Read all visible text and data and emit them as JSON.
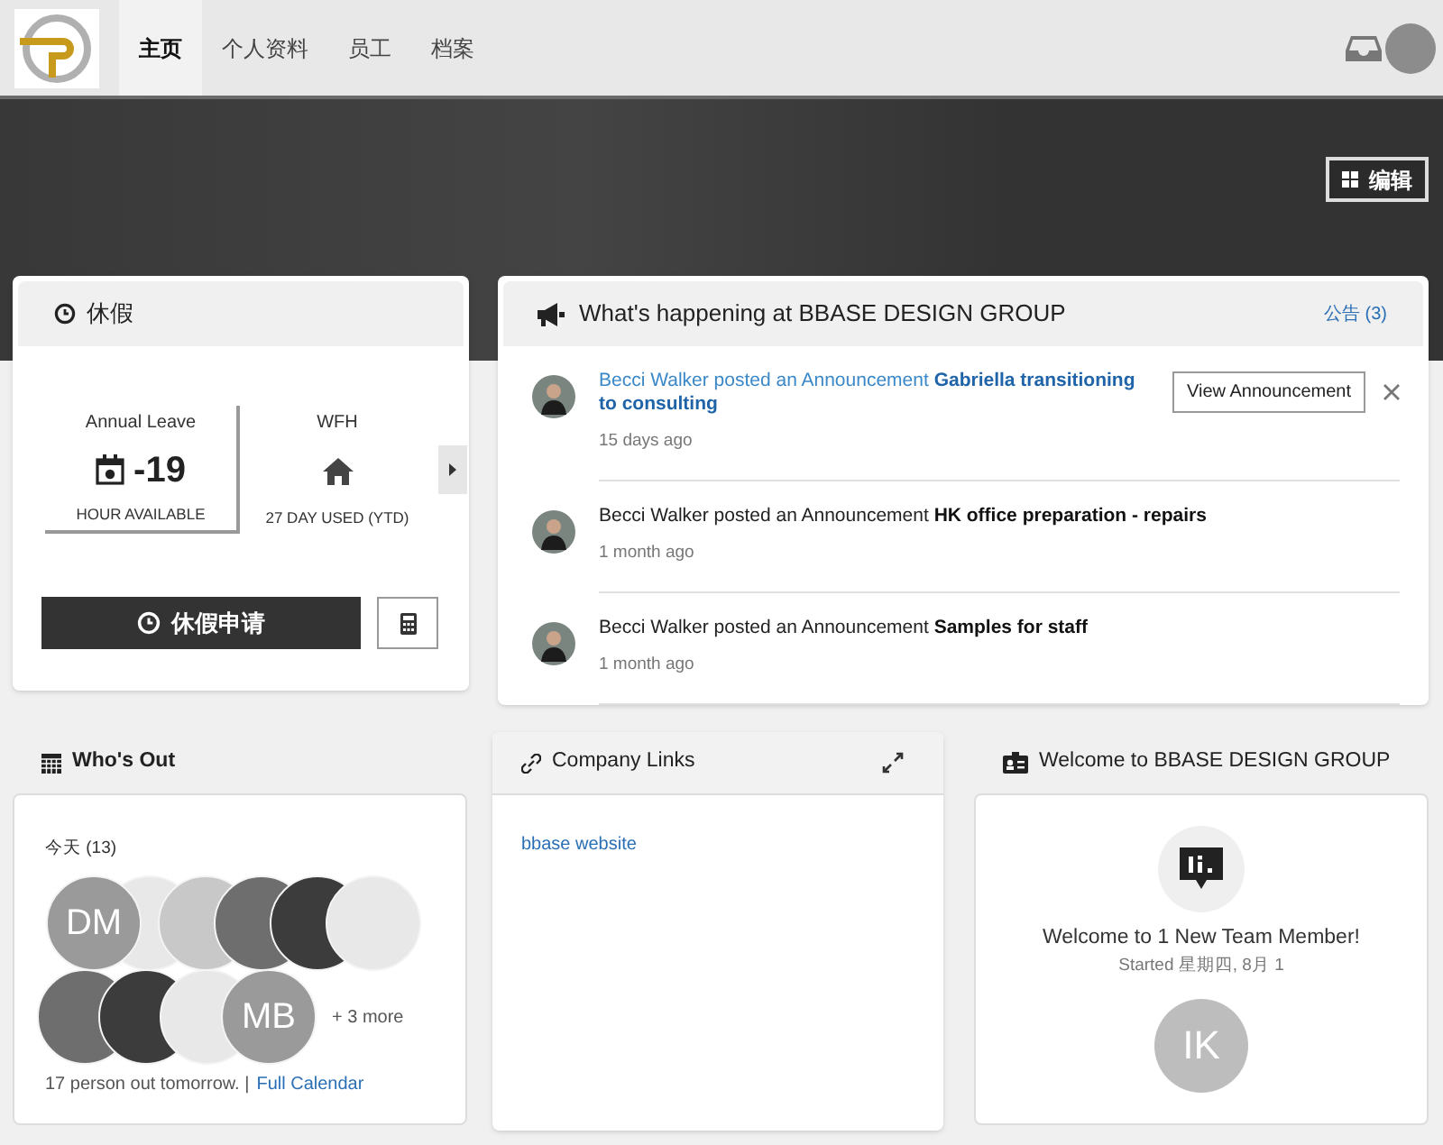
{
  "header": {
    "nav": [
      {
        "label": "主页",
        "selected": true
      },
      {
        "label": "个人资料",
        "selected": false
      },
      {
        "label": "员工",
        "selected": false
      },
      {
        "label": "档案",
        "selected": false
      }
    ]
  },
  "banner": {
    "edit_button": "编辑"
  },
  "leave_card": {
    "title": "休假",
    "balances": [
      {
        "name": "Annual Leave",
        "value": "-19",
        "caption": "HOUR AVAILABLE",
        "kind": "calendar",
        "selected": true
      },
      {
        "name": "WFH",
        "caption": "27 DAY USED (YTD)",
        "kind": "home",
        "selected": false
      }
    ],
    "request_button": "休假申请"
  },
  "announcements": {
    "title": "What's happening at BBASE DESIGN GROUP",
    "count_link": "公告 (3)",
    "view_button": "View Announcement",
    "items": [
      {
        "prefix": "Becci Walker posted an Announcement",
        "subject": "Gabriella transitioning to consulting",
        "time": "15 days ago",
        "hovered": true
      },
      {
        "prefix": "Becci Walker posted an Announcement",
        "subject": "HK office preparation - repairs",
        "time": "1 month ago",
        "hovered": false
      },
      {
        "prefix": "Becci Walker posted an Announcement",
        "subject": "Samples for staff",
        "time": "1 month ago",
        "hovered": false
      }
    ]
  },
  "whos_out": {
    "title": "Who's Out",
    "today": "今天 (13)",
    "avatar_rows": [
      [
        {
          "initials": "DM",
          "color": "#9a9a9a"
        },
        {
          "color": "#e8e8e8"
        },
        {
          "color": "#c8c8c8"
        },
        {
          "color": "#6e6e6e"
        },
        {
          "color": "#3c3c3c"
        },
        {
          "color": "#e8e8e8"
        }
      ],
      [
        {
          "color": "#6e6e6e"
        },
        {
          "color": "#3c3c3c"
        },
        {
          "color": "#e8e8e8"
        },
        {
          "initials": "MB",
          "color": "#9a9a9a"
        }
      ]
    ],
    "more": "+ 3 more",
    "tomorrow": "17 person out tomorrow. |",
    "calendar_link": "Full Calendar"
  },
  "company_links": {
    "title": "Company Links",
    "links": [
      "bbase website"
    ]
  },
  "welcome": {
    "title": "Welcome to BBASE DESIGN GROUP",
    "message": "Welcome to 1 New Team Member!",
    "started": "Started 星期四, 8月 1",
    "members": [
      {
        "initials": "IK"
      }
    ]
  }
}
